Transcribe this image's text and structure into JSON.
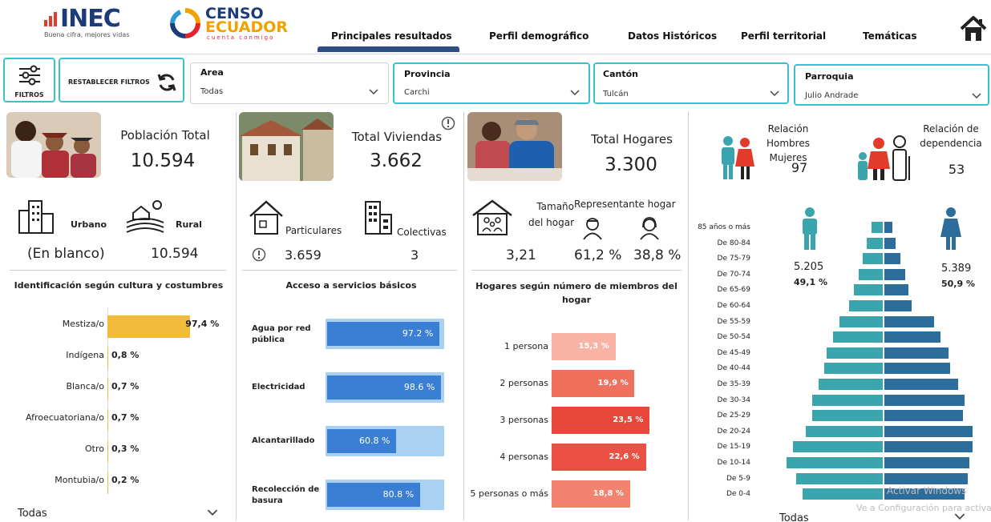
{
  "header": {
    "inec_logo": "INEC",
    "inec_tagline": "Buena cifra, mejores vidas",
    "censo_logo_line1": "CENSO",
    "censo_logo_line2": "ECUADOR",
    "censo_logo_line3": "cuenta conmigo",
    "nav": [
      "Principales resultados",
      "Perfil demográfico",
      "Datos Históricos",
      "Perfil territorial",
      "Temáticas"
    ]
  },
  "filters": {
    "filters_label": "FILTROS",
    "reset_label": "RESTABLECER FILTROS",
    "area": {
      "label": "Area",
      "value": "Todas"
    },
    "provincia": {
      "label": "Provincia",
      "value": "Carchi"
    },
    "canton": {
      "label": "Cantón",
      "value": "Tulcán"
    },
    "parroquia": {
      "label": "Parroquia",
      "value": "Julio Andrade"
    }
  },
  "kpis": {
    "poblacion": {
      "label": "Población Total",
      "value": "10.594"
    },
    "viviendas": {
      "label": "Total Viviendas",
      "value": "3.662"
    },
    "hogares": {
      "label": "Total Hogares",
      "value": "3.300"
    },
    "relacion_hm": {
      "label_line1": "Relación Hombres",
      "label_line2": "Mujeres",
      "value": "97"
    },
    "dependencia": {
      "label_line1": "Relación de",
      "label_line2": "dependencia",
      "value": "53"
    }
  },
  "area_split": {
    "urbano_label": "Urbano",
    "rural_label": "Rural",
    "urbano_value": "(En blanco)",
    "rural_value": "10.594"
  },
  "viviendas_split": {
    "particulares_label": "Particulares",
    "colectivas_label": "Colectivas",
    "particulares_value": "3.659",
    "colectivas_value": "3"
  },
  "hogar_stats": {
    "tamano_line1": "Tamaño",
    "tamano_line2": "del hogar",
    "tamano_value": "3,21",
    "representante_label": "Representante hogar",
    "rep_hombre": "61,2 %",
    "rep_mujer": "38,8 %"
  },
  "cultura": {
    "title": "Identificación según cultura y costumbres",
    "items": [
      {
        "label": "Mestiza/o",
        "value": 97.4,
        "text": "97,4 %"
      },
      {
        "label": "Indígena",
        "value": 0.8,
        "text": "0,8 %"
      },
      {
        "label": "Blanca/o",
        "value": 0.7,
        "text": "0,7 %"
      },
      {
        "label": "Afroecuatoriana/o",
        "value": 0.7,
        "text": "0,7 %"
      },
      {
        "label": "Otro",
        "value": 0.3,
        "text": "0,3 %"
      },
      {
        "label": "Montubia/o",
        "value": 0.2,
        "text": "0,2 %"
      }
    ],
    "bar_color": "#f2bc3a",
    "selector": "Todas"
  },
  "servicios": {
    "title": "Acceso a servicios básicos",
    "items": [
      {
        "label_line1": "Agua por red",
        "label_line2": "pública",
        "value": 97.2,
        "text": "97.2 %"
      },
      {
        "label_line1": "Electricidad",
        "label_line2": "",
        "value": 98.6,
        "text": "98.6 %"
      },
      {
        "label_line1": "Alcantarillado",
        "label_line2": "",
        "value": 60.8,
        "text": "60.8 %"
      },
      {
        "label_line1": "Recolección de",
        "label_line2": "basura",
        "value": 80.8,
        "text": "80.8 %"
      }
    ],
    "bar_color": "#3b7fd4",
    "track_color": "#a9d2f2"
  },
  "miembros": {
    "title_line1": "Hogares según número de miembros del",
    "title_line2": "hogar",
    "items": [
      {
        "label": "1 persona",
        "value": 15.3,
        "text": "15,3 %",
        "color": "#f8b3a5"
      },
      {
        "label": "2 personas",
        "value": 19.9,
        "text": "19,9 %",
        "color": "#f0705e"
      },
      {
        "label": "3 personas",
        "value": 23.5,
        "text": "23,5 %",
        "color": "#e8483b"
      },
      {
        "label": "4 personas",
        "value": 22.6,
        "text": "22,6 %",
        "color": "#ea5043"
      },
      {
        "label": "5 personas o más",
        "value": 18.8,
        "text": "18,8 %",
        "color": "#f3836f"
      }
    ]
  },
  "piramide": {
    "hombres_total": "5.205",
    "hombres_pct": "49,1 %",
    "mujeres_total": "5.389",
    "mujeres_pct": "50,9 %",
    "groups": [
      "85 años o más",
      "De 80-84",
      "De 75-79",
      "De 70-74",
      "De 65-69",
      "De 60-64",
      "De 55-59",
      "De 50-54",
      "De 45-49",
      "De 40-44",
      "De 35-39",
      "De 30-34",
      "De 25-29",
      "De 20-24",
      "De 15-19",
      "De 10-14",
      "De 5-9",
      "De 0-4"
    ],
    "male": [
      14,
      20,
      25,
      30,
      36,
      42,
      54,
      62,
      70,
      73,
      80,
      88,
      88,
      96,
      112,
      120,
      108,
      100
    ],
    "female": [
      10,
      14,
      20,
      26,
      30,
      34,
      62,
      70,
      80,
      82,
      92,
      100,
      98,
      110,
      110,
      106,
      104,
      100
    ],
    "male_color": "#3aa5ad",
    "female_color": "#2d6d9c",
    "selector": "Todas"
  },
  "watermark": {
    "line1": "Activar Windows",
    "line2": "Ve a Configuración para activar"
  }
}
